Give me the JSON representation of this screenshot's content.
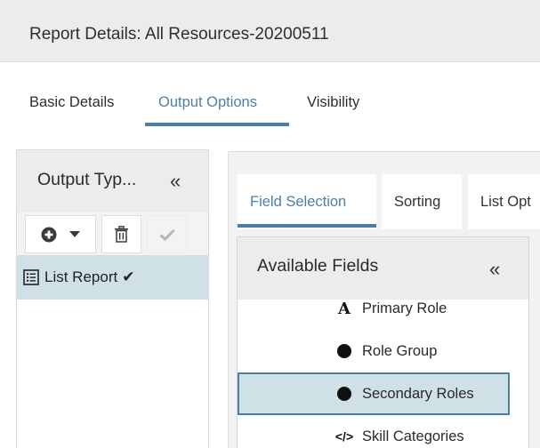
{
  "modal": {
    "title": "Report Details: All Resources-20200511"
  },
  "tabs": [
    {
      "label": "Basic Details",
      "active": false
    },
    {
      "label": "Output Options",
      "active": true
    },
    {
      "label": "Visibility",
      "active": false
    }
  ],
  "output_types": {
    "title": "Output Typ...",
    "collapse_glyph": "«",
    "toolbar": {
      "add_icon": "plus-circle-icon",
      "dropdown_icon": "caret-down-icon",
      "delete_icon": "trash-icon",
      "confirm_icon": "check-icon",
      "confirm_disabled": true
    },
    "items": [
      {
        "label": "List Report",
        "icon": "list-icon",
        "checkmark": "✔",
        "selected": true
      }
    ]
  },
  "sub_tabs": [
    {
      "label": "Field Selection",
      "active": true
    },
    {
      "label": "Sorting",
      "active": false
    },
    {
      "label": "List Opt",
      "active": false
    }
  ],
  "available_fields": {
    "title": "Available Fields",
    "collapse_glyph": "«",
    "items": [
      {
        "label": "Primary Role",
        "icon": "text-type-icon",
        "glyph": "A",
        "selected": false
      },
      {
        "label": "Role Group",
        "icon": "dot-icon",
        "selected": false
      },
      {
        "label": "Secondary Roles",
        "icon": "dot-icon",
        "selected": true
      },
      {
        "label": "Skill Categories",
        "icon": "code-icon",
        "glyph": "</>",
        "selected": false
      }
    ]
  },
  "colors": {
    "accent": "#4d7fa6",
    "header_bg": "#ececec",
    "selected_bg": "#cfe0e6",
    "text": "#2e2e2e"
  }
}
